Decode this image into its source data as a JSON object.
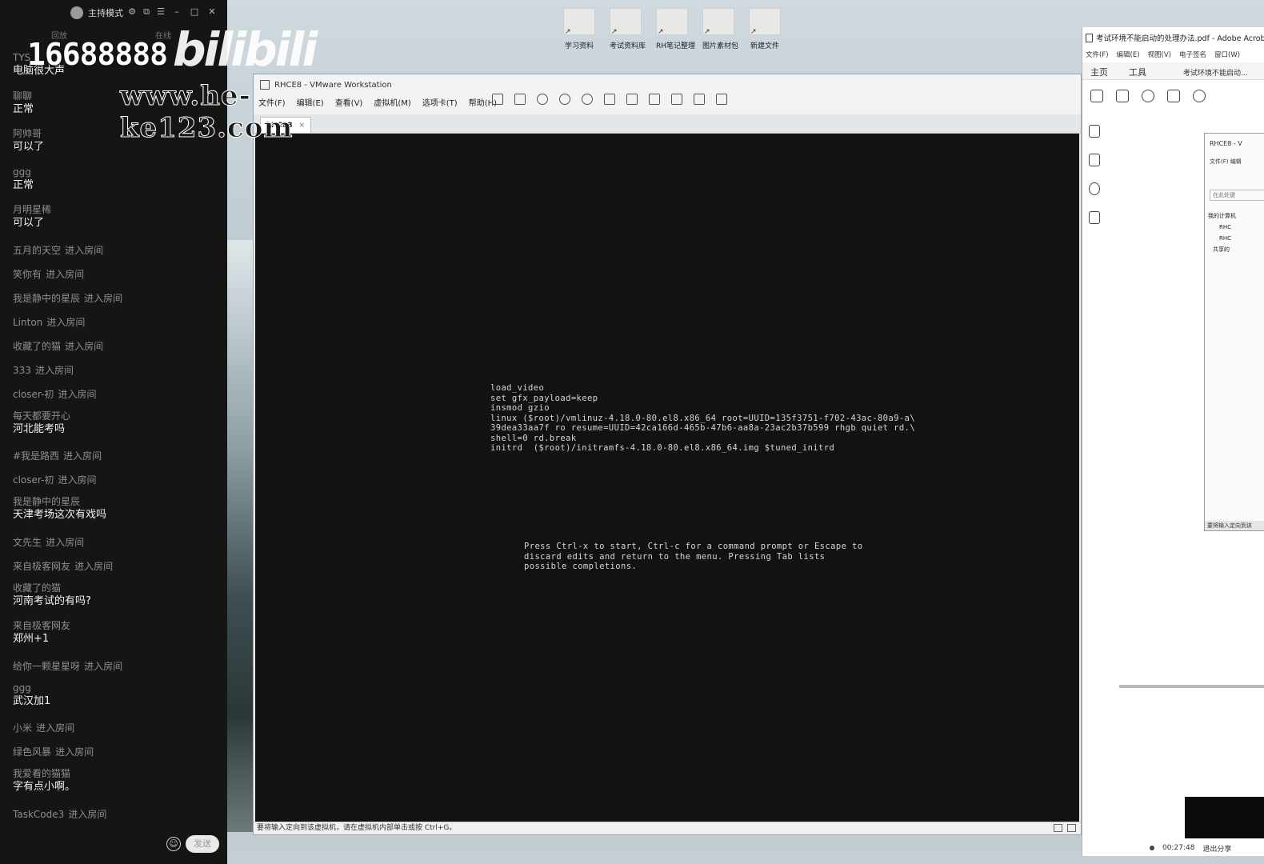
{
  "chat": {
    "mode_label": "主持模式",
    "header_left": "回放",
    "header_right": "在线",
    "messages": [
      {
        "user": "TYS",
        "text": "电脑很大声"
      },
      {
        "user": "聊聊",
        "text": "正常"
      },
      {
        "user": "阿帅哥",
        "text": "可以了"
      },
      {
        "user": "ggg",
        "text": "正常"
      },
      {
        "user": "月明星稀",
        "text": "可以了"
      },
      {
        "user": "五月的天空",
        "join": "进入房间"
      },
      {
        "user": "笑你有",
        "join": "进入房间"
      },
      {
        "user": "我是静中的星辰",
        "join": "进入房间"
      },
      {
        "user": "Linton",
        "join": "进入房间"
      },
      {
        "user": "收藏了的猫",
        "join": "进入房间"
      },
      {
        "user": "333",
        "join": "进入房间"
      },
      {
        "user": "closer-初",
        "join": "进入房间"
      },
      {
        "user": "每天都要开心",
        "text": "河北能考吗"
      },
      {
        "user": "#我是路西",
        "join": "进入房间"
      },
      {
        "user": "closer-初",
        "join": "进入房间"
      },
      {
        "user": "我是静中的星辰",
        "text": "天津考场这次有戏吗"
      },
      {
        "user": "文先生",
        "join": "进入房间"
      },
      {
        "user": "来自极客网友",
        "join": "进入房间"
      },
      {
        "user": "收藏了的猫",
        "text": "河南考试的有吗?"
      },
      {
        "user": "来自极客网友",
        "text": "郑州+1"
      },
      {
        "user": "给你一颗星星呀",
        "join": "进入房间"
      },
      {
        "user": "ggg",
        "text": "武汉加1"
      },
      {
        "user": "小米",
        "join": "进入房间"
      },
      {
        "user": "绿色风暴",
        "join": "进入房间"
      },
      {
        "user": "我爱看的猫猫",
        "text": "字有点小啊。"
      },
      {
        "user": "TaskCode3",
        "join": "进入房间"
      }
    ],
    "send_label": "发送"
  },
  "watermark": {
    "phone": "16688888",
    "logo": "bilibili",
    "url": "www.he-ke123.com"
  },
  "desktop": {
    "icons": [
      "学习资料",
      "考试资料库",
      "RH笔记整理",
      "图片素材包",
      "新建文件"
    ]
  },
  "vmware": {
    "title": "RHCE8 - VMware Workstation",
    "menu": [
      "文件(F)",
      "编辑(E)",
      "查看(V)",
      "虚拟机(M)",
      "选项卡(T)",
      "帮助(H)"
    ],
    "tab_label": "RHCE8",
    "grub_lines": [
      "load_video",
      "set gfx_payload=keep",
      "insmod gzio",
      "linux ($root)/vmlinuz-4.18.0-80.el8.x86_64 root=UUID=135f3751-f702-43ac-80a9-a\\",
      "39dea33aa7f ro resume=UUID=42ca166d-465b-47b6-aa8a-23ac2b37b599 rhgb quiet rd.\\",
      "shell=0 rd.break",
      "initrd  ($root)/initramfs-4.18.0-80.el8.x86_64.img $tuned_initrd"
    ],
    "grub_help": [
      "Press Ctrl-x to start, Ctrl-c for a command prompt or Escape to",
      "discard edits and return to the menu. Pressing Tab lists",
      "possible completions."
    ],
    "status_text": "要将输入定向到该虚拟机，请在虚拟机内部单击或按 Ctrl+G。"
  },
  "acrobat": {
    "title": "考试环境不能启动的处理办法.pdf - Adobe Acrobat",
    "menu": [
      "文件(F)",
      "编辑(E)",
      "视图(V)",
      "电子签名",
      "窗口(W)"
    ],
    "tab_home": "主页",
    "tab_tools": "工具",
    "doc_tab": "考试环境不能启动...",
    "mini": {
      "title": "RHCE8 - V",
      "menu": "文件(F)  编辑",
      "search": "在此处键",
      "tree": [
        "我的计算机",
        "RHC",
        "RHC",
        "共享的"
      ],
      "footer": "要将输入定向到该"
    },
    "timer": "00:27:48",
    "exit_share": "退出分享"
  }
}
